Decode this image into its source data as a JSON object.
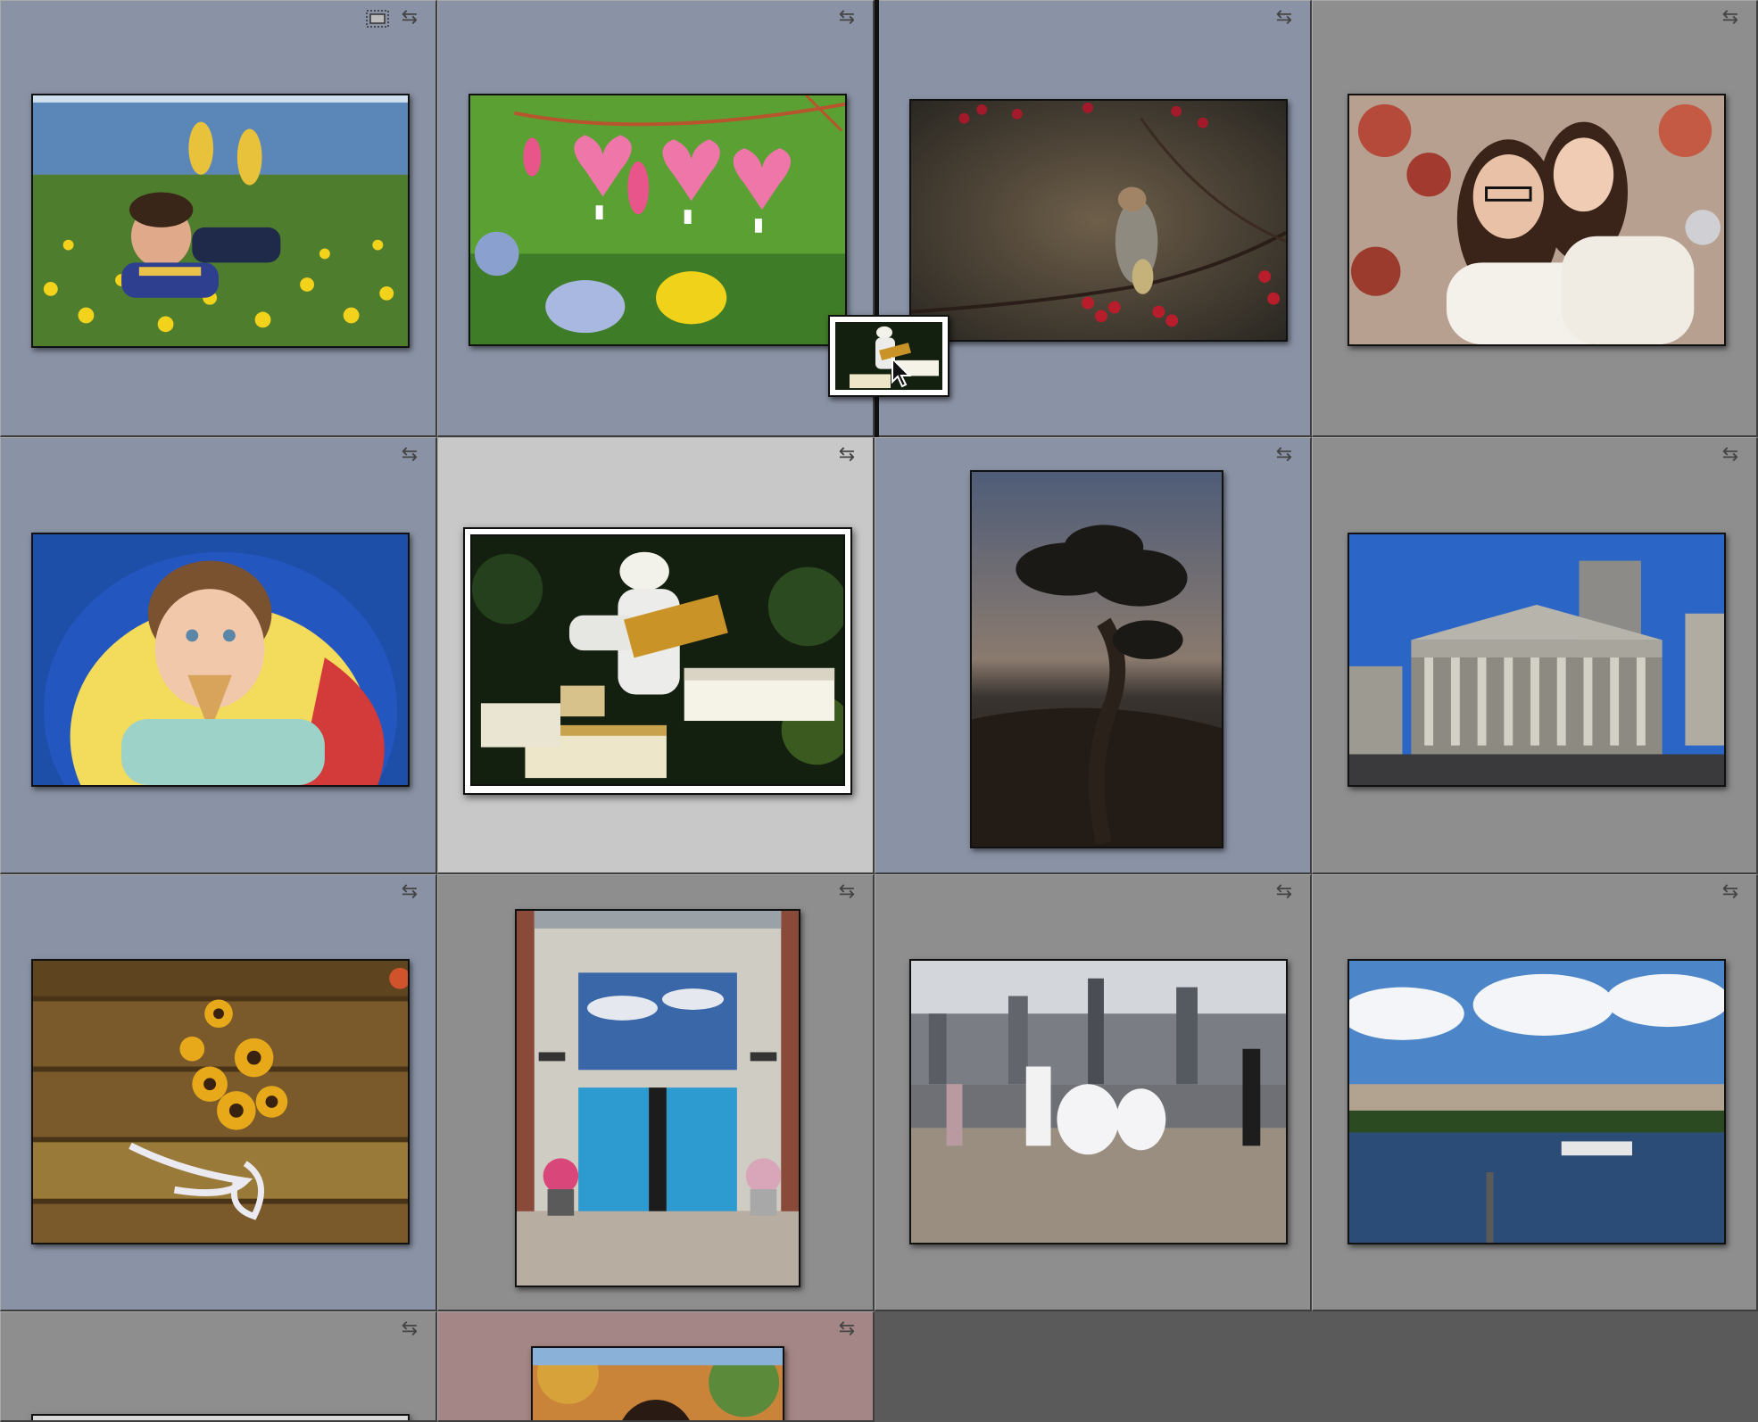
{
  "icons": {
    "sync": "sync-arrows-icon",
    "crop": "crop-frame-icon",
    "cursor": "mouse-pointer-icon"
  },
  "colors": {
    "cell_blue": "#8a93a6",
    "cell_gray": "#8e8e8e",
    "cell_selected": "#c8c8c8",
    "cell_red": "#a58686",
    "empty": "#5a5a5a"
  },
  "grid": {
    "cells": [
      {
        "row": 1,
        "col": 1,
        "label": "tint-blue",
        "subject": "boy-in-dandelion-field",
        "badges": [
          "crop",
          "sync"
        ]
      },
      {
        "row": 1,
        "col": 2,
        "label": "tint-blue",
        "subject": "bleeding-heart-flowers",
        "badges": [
          "sync"
        ]
      },
      {
        "row": 1,
        "col": 3,
        "label": "tint-blue",
        "subject": "cedar-waxwing-on-berry-branch",
        "badges": [
          "sync"
        ]
      },
      {
        "row": 1,
        "col": 4,
        "label": "none",
        "subject": "two-girls-portrait",
        "badges": [
          "sync"
        ]
      },
      {
        "row": 2,
        "col": 1,
        "label": "tint-blue",
        "subject": "boy-eating-ice-cream-cone",
        "badges": [
          "sync"
        ]
      },
      {
        "row": 2,
        "col": 2,
        "label": "selected",
        "subject": "beekeeper-with-hives",
        "badges": [
          "sync"
        ]
      },
      {
        "row": 2,
        "col": 3,
        "label": "tint-blue",
        "subject": "juniper-tree-silhouette",
        "badges": [
          "sync"
        ]
      },
      {
        "row": 2,
        "col": 4,
        "label": "none",
        "subject": "courthouse-building",
        "badges": [
          "sync"
        ]
      },
      {
        "row": 3,
        "col": 1,
        "label": "tint-blue",
        "subject": "sunflowers-on-wood-table",
        "badges": [
          "sync"
        ]
      },
      {
        "row": 3,
        "col": 2,
        "label": "none",
        "subject": "school-blue-doors",
        "badges": [
          "sync"
        ]
      },
      {
        "row": 3,
        "col": 3,
        "label": "none",
        "subject": "wedding-party-on-pier",
        "badges": [
          "sync"
        ]
      },
      {
        "row": 3,
        "col": 4,
        "label": "none",
        "subject": "harbor-skyline-boat",
        "badges": [
          "sync"
        ]
      },
      {
        "row": 4,
        "col": 1,
        "label": "none",
        "subject": "partial-thumbnail",
        "badges": [
          "sync"
        ]
      },
      {
        "row": 4,
        "col": 2,
        "label": "tint-red",
        "subject": "portrait-autumn-trees",
        "badges": [
          "sync"
        ]
      }
    ]
  },
  "drag": {
    "subject": "beekeeper-with-hives",
    "drop_target": "between-column-2-and-3-row-1"
  }
}
